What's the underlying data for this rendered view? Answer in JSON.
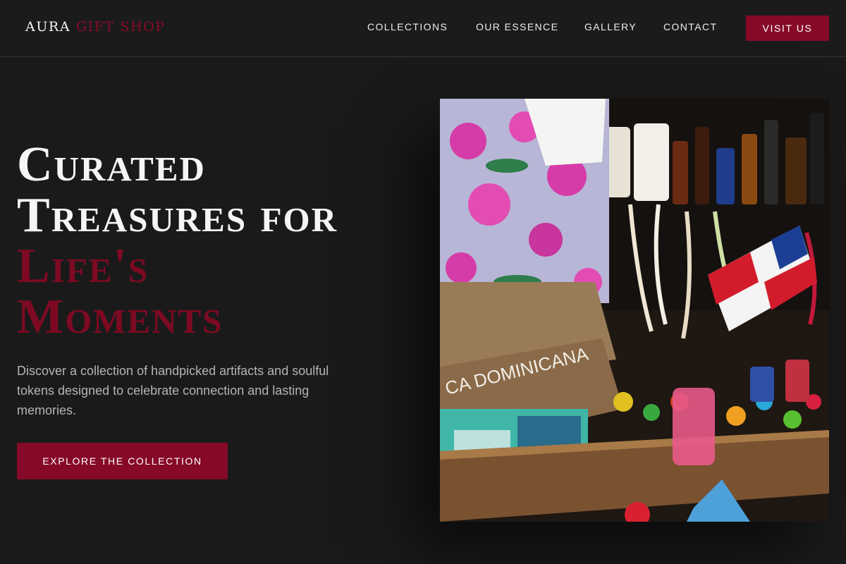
{
  "nav": {
    "logo_brand": "AURA",
    "logo_accent": "GIFT SHOP",
    "links": [
      "COLLECTIONS",
      "OUR ESSENCE",
      "GALLERY",
      "CONTACT"
    ],
    "cta": "VISIT US"
  },
  "hero": {
    "title_lines": [
      "Curated",
      "Treasures for"
    ],
    "title_accent_lines": [
      "Life's",
      "Moments"
    ],
    "description": "Discover a collection of handpicked artifacts and soulful tokens designed to celebrate connection and lasting memories.",
    "cta": "EXPLORE THE COLLECTION",
    "image_text": "CA DOMINICANA"
  },
  "colors": {
    "background": "#1a1a1b",
    "accent": "#860a27",
    "text": "#f2f2f2",
    "muted": "#b4b4b8"
  }
}
